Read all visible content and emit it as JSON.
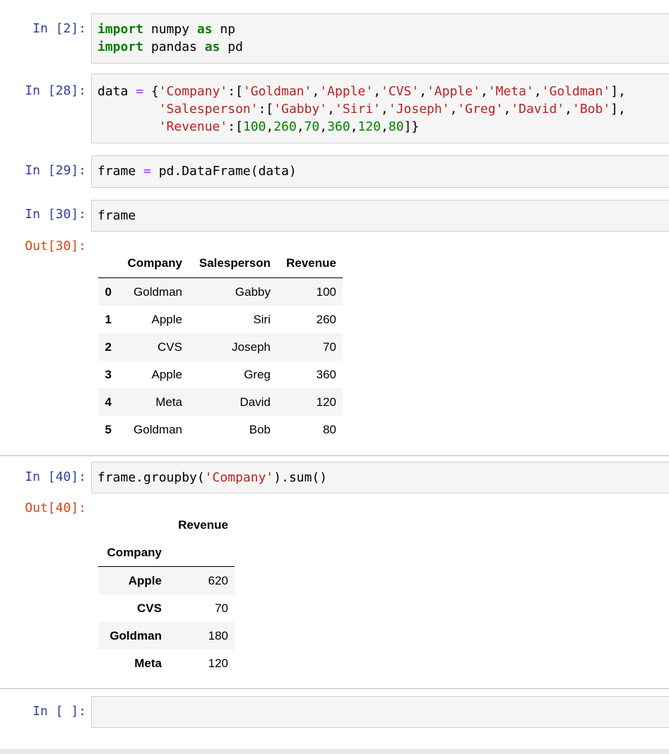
{
  "cells": [
    {
      "prompt": "In [2]:",
      "code_lines": [
        [
          {
            "t": "import",
            "c": "kw"
          },
          {
            "t": " numpy ",
            "c": ""
          },
          {
            "t": "as",
            "c": "kw"
          },
          {
            "t": " np",
            "c": ""
          }
        ],
        [
          {
            "t": "import",
            "c": "kw"
          },
          {
            "t": " pandas ",
            "c": ""
          },
          {
            "t": "as",
            "c": "kw"
          },
          {
            "t": " pd",
            "c": ""
          }
        ]
      ]
    },
    {
      "prompt": "In [28]:",
      "code_lines": [
        [
          {
            "t": "data ",
            "c": ""
          },
          {
            "t": "=",
            "c": "op"
          },
          {
            "t": " {",
            "c": ""
          },
          {
            "t": "'Company'",
            "c": "str"
          },
          {
            "t": ":[",
            "c": ""
          },
          {
            "t": "'Goldman'",
            "c": "str"
          },
          {
            "t": ",",
            "c": ""
          },
          {
            "t": "'Apple'",
            "c": "str"
          },
          {
            "t": ",",
            "c": ""
          },
          {
            "t": "'CVS'",
            "c": "str"
          },
          {
            "t": ",",
            "c": ""
          },
          {
            "t": "'Apple'",
            "c": "str"
          },
          {
            "t": ",",
            "c": ""
          },
          {
            "t": "'Meta'",
            "c": "str"
          },
          {
            "t": ",",
            "c": ""
          },
          {
            "t": "'Goldman'",
            "c": "str"
          },
          {
            "t": "],",
            "c": ""
          }
        ],
        [
          {
            "t": "        ",
            "c": ""
          },
          {
            "t": "'Salesperson'",
            "c": "str"
          },
          {
            "t": ":[",
            "c": ""
          },
          {
            "t": "'Gabby'",
            "c": "str"
          },
          {
            "t": ",",
            "c": ""
          },
          {
            "t": "'Siri'",
            "c": "str"
          },
          {
            "t": ",",
            "c": ""
          },
          {
            "t": "'Joseph'",
            "c": "str"
          },
          {
            "t": ",",
            "c": ""
          },
          {
            "t": "'Greg'",
            "c": "str"
          },
          {
            "t": ",",
            "c": ""
          },
          {
            "t": "'David'",
            "c": "str"
          },
          {
            "t": ",",
            "c": ""
          },
          {
            "t": "'Bob'",
            "c": "str"
          },
          {
            "t": "],",
            "c": ""
          }
        ],
        [
          {
            "t": "        ",
            "c": ""
          },
          {
            "t": "'Revenue'",
            "c": "str"
          },
          {
            "t": ":[",
            "c": ""
          },
          {
            "t": "100",
            "c": "num"
          },
          {
            "t": ",",
            "c": ""
          },
          {
            "t": "260",
            "c": "num"
          },
          {
            "t": ",",
            "c": ""
          },
          {
            "t": "70",
            "c": "num"
          },
          {
            "t": ",",
            "c": ""
          },
          {
            "t": "360",
            "c": "num"
          },
          {
            "t": ",",
            "c": ""
          },
          {
            "t": "120",
            "c": "num"
          },
          {
            "t": ",",
            "c": ""
          },
          {
            "t": "80",
            "c": "num"
          },
          {
            "t": "]}",
            "c": ""
          }
        ]
      ]
    },
    {
      "prompt": "In [29]:",
      "code_lines": [
        [
          {
            "t": "frame ",
            "c": ""
          },
          {
            "t": "=",
            "c": "op"
          },
          {
            "t": " pd.DataFrame(data)",
            "c": ""
          }
        ]
      ]
    },
    {
      "prompt": "In [30]:",
      "code_lines": [
        [
          {
            "t": "frame",
            "c": ""
          }
        ]
      ]
    },
    {
      "prompt": "In [40]:",
      "code_lines": [
        [
          {
            "t": "frame.groupby(",
            "c": ""
          },
          {
            "t": "'Company'",
            "c": "str"
          },
          {
            "t": ").sum()",
            "c": ""
          }
        ]
      ]
    },
    {
      "prompt": "In [ ]:",
      "code_lines": []
    }
  ],
  "out30": {
    "prompt": "Out[30]:",
    "columns": [
      "Company",
      "Salesperson",
      "Revenue"
    ],
    "rows": [
      {
        "index": "0",
        "values": [
          "Goldman",
          "Gabby",
          "100"
        ]
      },
      {
        "index": "1",
        "values": [
          "Apple",
          "Siri",
          "260"
        ]
      },
      {
        "index": "2",
        "values": [
          "CVS",
          "Joseph",
          "70"
        ]
      },
      {
        "index": "3",
        "values": [
          "Apple",
          "Greg",
          "360"
        ]
      },
      {
        "index": "4",
        "values": [
          "Meta",
          "David",
          "120"
        ]
      },
      {
        "index": "5",
        "values": [
          "Goldman",
          "Bob",
          "80"
        ]
      }
    ]
  },
  "out40": {
    "prompt": "Out[40]:",
    "column": "Revenue",
    "index_name": "Company",
    "rows": [
      {
        "index": "Apple",
        "value": "620"
      },
      {
        "index": "CVS",
        "value": "70"
      },
      {
        "index": "Goldman",
        "value": "180"
      },
      {
        "index": "Meta",
        "value": "120"
      }
    ]
  }
}
